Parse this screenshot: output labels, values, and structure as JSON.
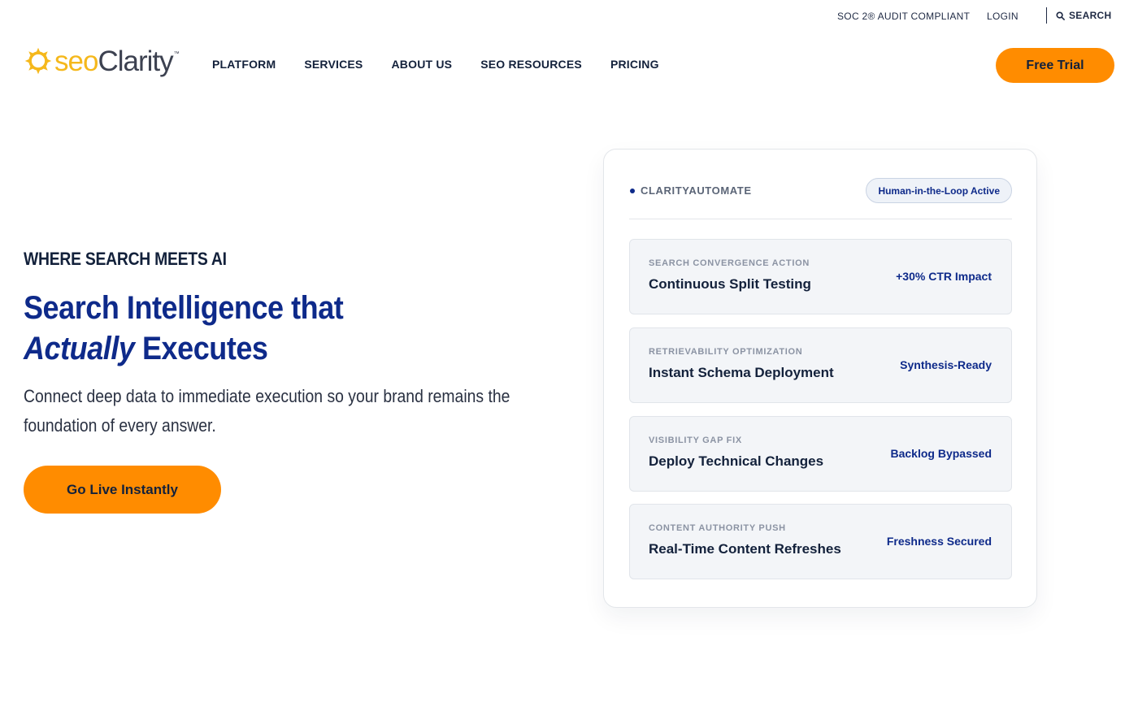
{
  "utility": {
    "soc": "SOC 2® AUDIT COMPLIANT",
    "login": "LOGIN",
    "search": "SEARCH"
  },
  "logo": {
    "seo": "seo",
    "clarity": "Clarity",
    "tm": "™",
    "colors": {
      "seo": "#f5b81c",
      "clarity": "#3c4150"
    }
  },
  "nav": {
    "items": [
      {
        "label": "PLATFORM"
      },
      {
        "label": "SERVICES"
      },
      {
        "label": "ABOUT US"
      },
      {
        "label": "SEO RESOURCES"
      },
      {
        "label": "PRICING"
      }
    ]
  },
  "header": {
    "cta_label": "Free Trial"
  },
  "hero": {
    "eyebrow": "WHERE SEARCH MEETS AI",
    "headline_line1": "Search Intelligence that",
    "headline_em": "Actually",
    "headline_rest": " Executes",
    "subtext": "Connect deep data to immediate execution so your brand remains the foundation of every answer.",
    "cta_label": "Go Live Instantly"
  },
  "card": {
    "title": "CLARITYAUTOMATE",
    "badge": "Human-in-the-Loop Active",
    "actions": [
      {
        "kicker": "SEARCH CONVERGENCE ACTION",
        "title": "Continuous Split Testing",
        "metric": "+30% CTR Impact"
      },
      {
        "kicker": "RETRIEVABILITY OPTIMIZATION",
        "title": "Instant Schema Deployment",
        "metric": "Synthesis-Ready"
      },
      {
        "kicker": "VISIBILITY GAP FIX",
        "title": "Deploy Technical Changes",
        "metric": "Backlog Bypassed"
      },
      {
        "kicker": "CONTENT AUTHORITY PUSH",
        "title": "Real-Time Content Refreshes",
        "metric": "Freshness Secured"
      }
    ]
  },
  "colors": {
    "accent_orange": "#ff8c00",
    "brand_blue": "#0e2a8a",
    "text_dark": "#13213b"
  },
  "icons": {
    "search": "search-icon",
    "logo_mark": "sun-logo-icon",
    "status_dot": "status-dot-icon"
  }
}
